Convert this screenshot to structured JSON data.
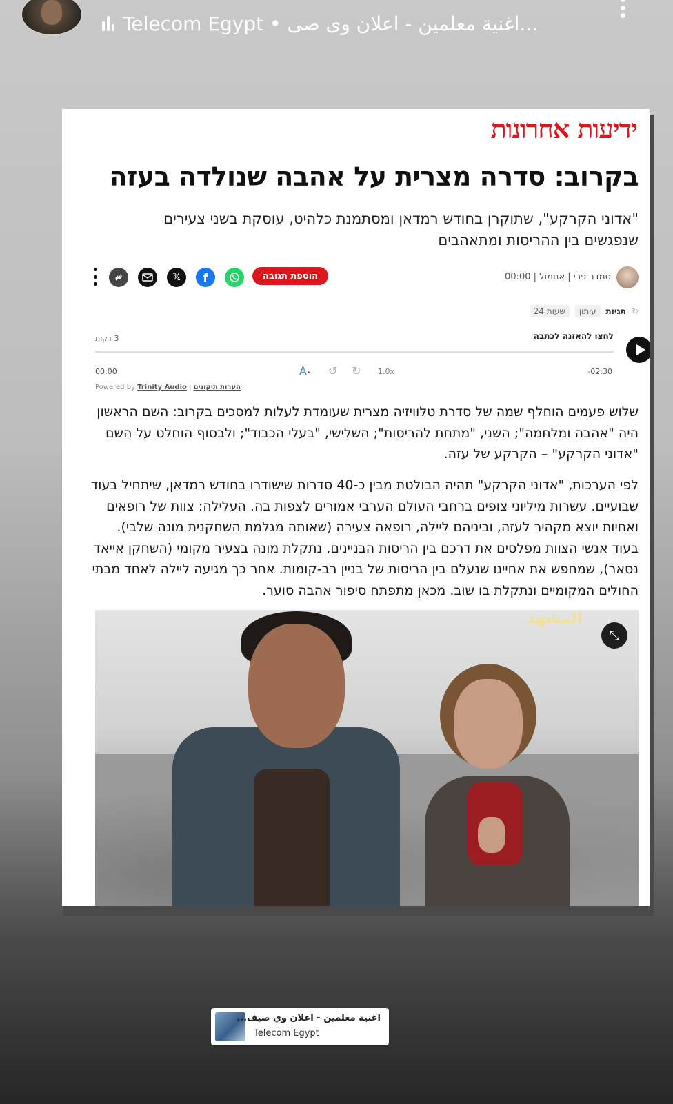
{
  "status": {
    "music_label": "Telecom Egypt • ...اغنية معلمين - اعلان وى صى",
    "music_artist": "Telecom Egypt",
    "music_separator": " • ",
    "music_track": "...اغنية معلمين - اعلان وى صى"
  },
  "article": {
    "logo": "ידיעות אחרונות",
    "headline": "בקרוב: סדרה מצרית על אהבה שנולדה בעזה",
    "subhead": "\"אדוני הקרקע\", שתוקרן בחודש רמדאן ומסתמנת כלהיט, עוסקת בשני צעירים שנפגשים בין ההריסות ומתאהבים",
    "author": "סמדר פרי",
    "date": "אתמול",
    "time": "00:00",
    "add_response": "הוספת תגובה",
    "tags_label": "תגיות",
    "tags": [
      "עיתון",
      "24 שעות"
    ],
    "player": {
      "listen_label": "לחצו להאזנה לכתבה",
      "read_time": "3 דקות",
      "current": "00:00",
      "remaining": "-02:30",
      "speed": "1.0x"
    },
    "powered_prefix": "Powered by",
    "powered_brand": "Trinity Audio",
    "powered_link": "הערות תיקונים",
    "paragraphs": [
      "שלוש פעמים הוחלף שמה של סדרת טלוויזיה מצרית שעומדת לעלות למסכים בקרוב: השם הראשון היה \"אהבה ומלחמה\"; השני, \"מתחת להריסות\"; השלישי, \"בעלי הכבוד\"; ולבסוף הוחלט על השם \"אדוני הקרקע\" – הקרקע של עזה.",
      "לפי הערכות, \"אדוני הקרקע\" תהיה הבולטת מבין כ-40 סדרות שישודרו בחודש רמדאן, שיתחיל בעוד שבועיים. עשרות מיליוני צופים ברחבי העולם הערבי אמורים לצפות בה. העלילה: צוות של רופאים ואחיות יוצא מקהיר לעזה, וביניהם ליילה, רופאה צעירה (שאותה מגלמת השחקנית מונה שלבי). בעוד אנשי הצוות מפלסים את דרכם בין הריסות הבניינים, נתקלת מונה בצעיר מקומי (השחקן אייאד נסאר), שמחפש את אחיינו שנעלם בין הריסות של בניין רב-קומות. אחר כך מגיעה ליילה לאחד מבתי החולים המקומיים ונתקלת בו שוב. מכאן מתפתח סיפור אהבה סוער."
    ],
    "photo_channel_logo": "المشهد"
  },
  "sticker": {
    "title": "اغنية معلمين - اعلان وي صيف...",
    "artist": "Telecom Egypt"
  },
  "colors": {
    "brand_red": "#d9171c",
    "whatsapp": "#25d366",
    "facebook": "#1877f2"
  },
  "icons": [
    "profile-avatar",
    "music-bars-icon",
    "more-dots-icon",
    "link-icon",
    "email-icon",
    "x-icon",
    "facebook-icon",
    "whatsapp-icon",
    "play-icon",
    "expand-icon"
  ]
}
